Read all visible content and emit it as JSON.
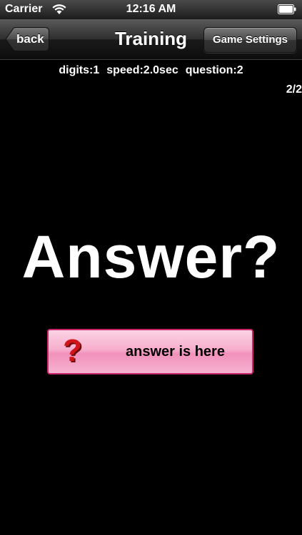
{
  "status_bar": {
    "carrier": "Carrier",
    "time": "12:16 AM",
    "wifi_icon": "wifi-icon",
    "battery_icon": "battery-icon"
  },
  "nav": {
    "back_label": "back",
    "title": "Training",
    "settings_label": "Game Settings"
  },
  "info": {
    "digits": "digits:1",
    "speed": "speed:2.0sec",
    "question": "question:2",
    "progress": "2/2"
  },
  "main": {
    "prompt": "Answer?",
    "answer_button_label": "answer is here",
    "answer_button_icon": "?"
  },
  "colors": {
    "background": "#000000",
    "button_pink": "#f7aecd",
    "button_border": "#c4286a",
    "icon_red": "#d2151a"
  }
}
